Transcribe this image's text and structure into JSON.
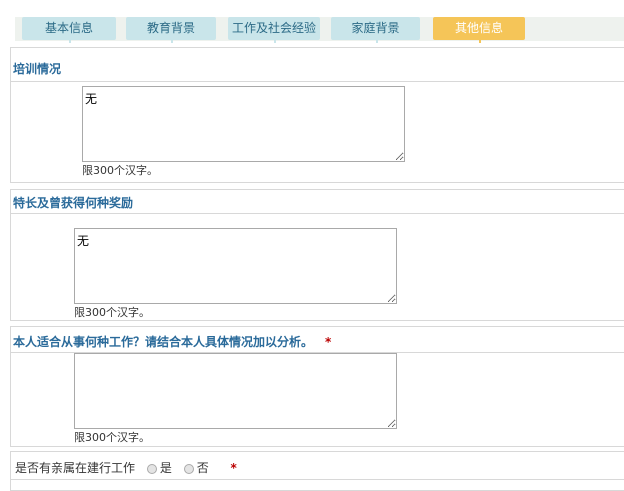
{
  "tabs": [
    {
      "label": "基本信息"
    },
    {
      "label": "教育背景"
    },
    {
      "label": "工作及社会经验"
    },
    {
      "label": "家庭背景"
    },
    {
      "label": "其他信息",
      "active": true
    }
  ],
  "sections": [
    {
      "title": "培训情况",
      "value": "无",
      "hint": "限300个汉字。"
    },
    {
      "title": "特长及曾获得何种奖励",
      "value": "无",
      "hint": "限300个汉字。"
    },
    {
      "title": "本人适合从事何种工作？请结合本人具体情况加以分析。",
      "value": "",
      "hint": "限300个汉字。",
      "required": "*"
    }
  ],
  "relatives": {
    "label": "是否有亲属在建行工作",
    "options": [
      "是",
      "否"
    ],
    "required": "*"
  }
}
